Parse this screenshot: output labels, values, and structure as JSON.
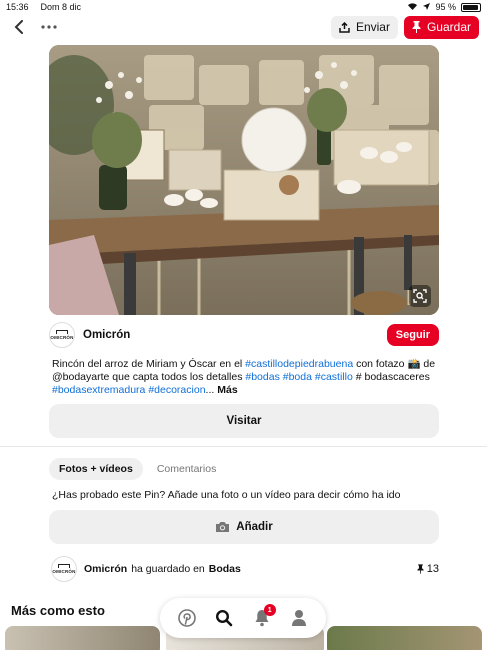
{
  "status_bar": {
    "time": "15:36",
    "date": "Dom 8 dic",
    "battery_percent": "95 %",
    "battery_level": 0.95
  },
  "top_bar": {
    "back_icon": "chevron-left-icon",
    "more_icon": "more-dots-icon",
    "send_label": "Enviar",
    "save_label": "Guardar"
  },
  "pin": {
    "image_alt_icon": "visual-search-icon",
    "creator_name": "Omicrón",
    "avatar_text": "OMICRÓN",
    "follow_label": "Seguir",
    "description": [
      {
        "text": "Rincón del arroz de Miriam y Óscar en el ",
        "tag": false
      },
      {
        "text": "#castillodepiedrabuena",
        "tag": true
      },
      {
        "text": " con fotazo 📸 de @bodayarte que capta todos los detalles ",
        "tag": false
      },
      {
        "text": "#bodas",
        "tag": true
      },
      {
        "text": " ",
        "tag": false
      },
      {
        "text": "#boda",
        "tag": true
      },
      {
        "text": " ",
        "tag": false
      },
      {
        "text": "#castillo",
        "tag": true
      },
      {
        "text": " # bodascaceres ",
        "tag": false
      },
      {
        "text": "#bodasextremadura",
        "tag": true
      },
      {
        "text": " ",
        "tag": false
      },
      {
        "text": "#decoracion",
        "tag": true
      },
      {
        "text": "...",
        "tag": false
      }
    ],
    "more_label": "Más",
    "visit_label": "Visitar"
  },
  "activity": {
    "tabs": [
      {
        "label": "Fotos + vídeos",
        "active": true
      },
      {
        "label": "Comentarios",
        "active": false
      }
    ],
    "prompt": "¿Has probado este Pin? Añade una foto o un vídeo para decir cómo ha ido",
    "add_label": "Añadir"
  },
  "saved": {
    "user": "Omicrón",
    "middle_text": "ha guardado en",
    "board": "Bodas",
    "count": "13"
  },
  "more_like_this": {
    "title": "Más como esto"
  },
  "bottom_nav": {
    "items": [
      "pinterest-logo-icon",
      "search-icon",
      "bell-icon",
      "profile-icon"
    ],
    "notification_count": "1"
  },
  "colors": {
    "brand_red": "#e60023",
    "hashtag_blue": "#0f6fd7",
    "button_gray": "#efefef"
  }
}
